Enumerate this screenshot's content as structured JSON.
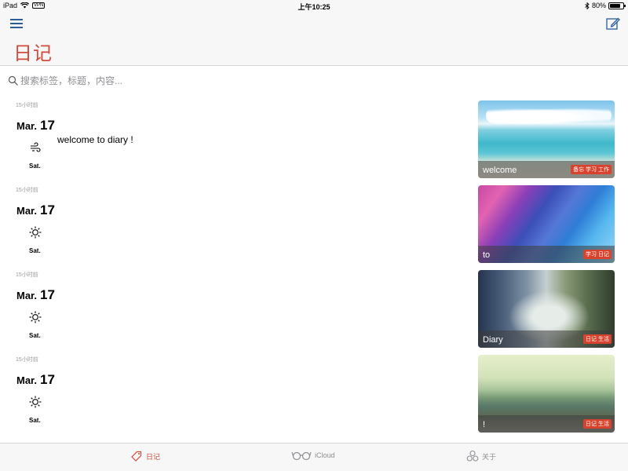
{
  "status_bar": {
    "device": "iPad",
    "vpn": "VPN",
    "time": "上午10:25",
    "battery": "80%",
    "battery_level": 0.8
  },
  "nav": {
    "title": "日记",
    "icons": {
      "menu": "menu-icon",
      "compose": "compose-icon"
    }
  },
  "search": {
    "placeholder": "搜索标签，标题，内容...",
    "value": ""
  },
  "entries": [
    {
      "ago": "15小时前",
      "month": "Mar.",
      "day": "17",
      "weekday": "Sat.",
      "weather": "wind-icon",
      "text": "welcome to diary !",
      "thumb_title": "welcome",
      "tags": "备忘 学习 工作"
    },
    {
      "ago": "15小时前",
      "month": "Mar.",
      "day": "17",
      "weekday": "Sat.",
      "weather": "sun-icon",
      "text": "",
      "thumb_title": "to",
      "tags": "学习 日记"
    },
    {
      "ago": "15小时前",
      "month": "Mar.",
      "day": "17",
      "weekday": "Sat.",
      "weather": "sun-icon",
      "text": "",
      "thumb_title": "Diary",
      "tags": "日记 生活"
    },
    {
      "ago": "15小时前",
      "month": "Mar.",
      "day": "17",
      "weekday": "Sat.",
      "weather": "sun-icon",
      "text": "",
      "thumb_title": "!",
      "tags": "日记 生活"
    }
  ],
  "tabs": [
    {
      "label": "日记",
      "icon": "tag-icon",
      "active": true
    },
    {
      "label": "iCloud",
      "icon": "glasses-icon",
      "active": false
    },
    {
      "label": "关于",
      "icon": "circles-icon",
      "active": false
    }
  ],
  "colors": {
    "accent": "#d14b3c",
    "nav_icon": "#2b5d98",
    "tag_badge": "#d9432e"
  }
}
